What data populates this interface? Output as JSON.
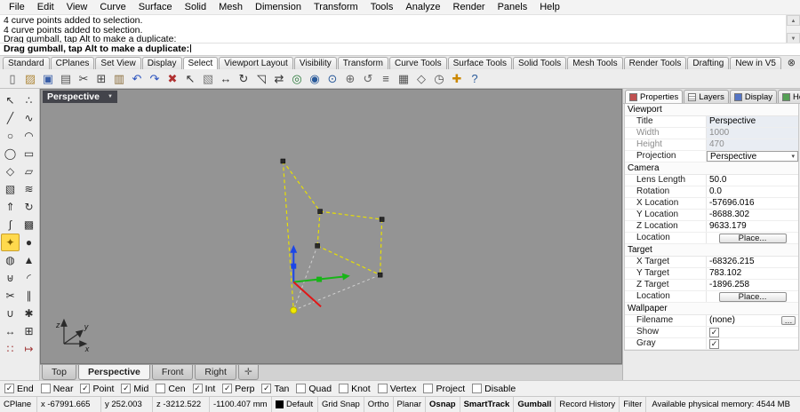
{
  "menu_bar": {
    "items": [
      "File",
      "Edit",
      "View",
      "Curve",
      "Surface",
      "Solid",
      "Mesh",
      "Dimension",
      "Transform",
      "Tools",
      "Analyze",
      "Render",
      "Panels",
      "Help"
    ]
  },
  "command_history": {
    "lines": [
      "4 curve points added to selection.",
      "4 curve points added to selection.",
      "Drag gumball, tap Alt to make a duplicate:"
    ]
  },
  "command_prompt": {
    "text": "Drag gumball, tap Alt to make a duplicate:"
  },
  "toolbar_tabs": {
    "items": [
      {
        "label": "Standard",
        "state": ""
      },
      {
        "label": "CPlanes",
        "state": ""
      },
      {
        "label": "Set View",
        "state": ""
      },
      {
        "label": "Display",
        "state": ""
      },
      {
        "label": "Select",
        "state": "active"
      },
      {
        "label": "Viewport Layout",
        "state": ""
      },
      {
        "label": "Visibility",
        "state": ""
      },
      {
        "label": "Transform",
        "state": ""
      },
      {
        "label": "Curve Tools",
        "state": ""
      },
      {
        "label": "Surface Tools",
        "state": ""
      },
      {
        "label": "Solid Tools",
        "state": ""
      },
      {
        "label": "Mesh Tools",
        "state": ""
      },
      {
        "label": "Render Tools",
        "state": ""
      },
      {
        "label": "Drafting",
        "state": ""
      },
      {
        "label": "New in V5",
        "state": ""
      }
    ]
  },
  "icon_toolbar": {
    "icons": [
      {
        "name": "new-file-icon",
        "glyph": "▯",
        "color": "#5a5a5a"
      },
      {
        "name": "open-file-icon",
        "glyph": "▨",
        "color": "#b08a3e"
      },
      {
        "name": "save-icon",
        "glyph": "▣",
        "color": "#3a5fa8"
      },
      {
        "name": "print-icon",
        "glyph": "▤",
        "color": "#5a5a5a"
      },
      {
        "name": "cut-icon",
        "glyph": "✂",
        "color": "#444444"
      },
      {
        "name": "copy-icon",
        "glyph": "⊞",
        "color": "#444444"
      },
      {
        "name": "paste-icon",
        "glyph": "▥",
        "color": "#8a6d3b"
      },
      {
        "name": "undo-icon",
        "glyph": "↶",
        "color": "#2a52be"
      },
      {
        "name": "redo-icon",
        "glyph": "↷",
        "color": "#2a52be"
      },
      {
        "name": "delete-icon",
        "glyph": "✖",
        "color": "#b03030"
      },
      {
        "name": "select-pointer-icon",
        "glyph": "↖",
        "color": "#333333"
      },
      {
        "name": "select-window-icon",
        "glyph": "▧",
        "color": "#7a7a7a"
      },
      {
        "name": "move-icon",
        "glyph": "↔",
        "color": "#333333"
      },
      {
        "name": "rotate-icon",
        "glyph": "↻",
        "color": "#333333"
      },
      {
        "name": "scale-icon",
        "glyph": "◹",
        "color": "#333333"
      },
      {
        "name": "mirror-icon",
        "glyph": "⇄",
        "color": "#333333"
      },
      {
        "name": "zoom-extents-icon",
        "glyph": "◎",
        "color": "#2a7a3a"
      },
      {
        "name": "zoom-window-icon",
        "glyph": "◉",
        "color": "#2a5a9a"
      },
      {
        "name": "zoom-selected-icon",
        "glyph": "⊙",
        "color": "#2a5a9a"
      },
      {
        "name": "pan-icon",
        "glyph": "⊕",
        "color": "#666666"
      },
      {
        "name": "undo-view-icon",
        "glyph": "↺",
        "color": "#666666"
      },
      {
        "name": "layers-icon",
        "glyph": "≡",
        "color": "#555555"
      },
      {
        "name": "display-mode-icon",
        "glyph": "▦",
        "color": "#555555"
      },
      {
        "name": "osnap-icon",
        "glyph": "◇",
        "color": "#555555"
      },
      {
        "name": "record-history-icon",
        "glyph": "◷",
        "color": "#555555"
      },
      {
        "name": "gumball-icon",
        "glyph": "✚",
        "color": "#cc8800"
      },
      {
        "name": "help-icon",
        "glyph": "?",
        "color": "#2a5a9a"
      }
    ]
  },
  "sidebar": {
    "tools": [
      {
        "name": "select-tool-icon",
        "glyph": "↖",
        "cls": ""
      },
      {
        "name": "point-tool-icon",
        "glyph": "∴",
        "cls": ""
      },
      {
        "name": "polyline-tool-icon",
        "glyph": "╱",
        "cls": ""
      },
      {
        "name": "curve-tool-icon",
        "glyph": "∿",
        "cls": ""
      },
      {
        "name": "circle-tool-icon",
        "glyph": "○",
        "cls": ""
      },
      {
        "name": "arc-tool-icon",
        "glyph": "◠",
        "cls": ""
      },
      {
        "name": "ellipse-tool-icon",
        "glyph": "◯",
        "cls": ""
      },
      {
        "name": "rectangle-tool-icon",
        "glyph": "▭",
        "cls": ""
      },
      {
        "name": "polygon-tool-icon",
        "glyph": "◇",
        "cls": ""
      },
      {
        "name": "plane-tool-icon",
        "glyph": "▱",
        "cls": ""
      },
      {
        "name": "surface-tool-icon",
        "glyph": "▧",
        "cls": ""
      },
      {
        "name": "loft-tool-icon",
        "glyph": "≋",
        "cls": ""
      },
      {
        "name": "extrude-tool-icon",
        "glyph": "⇑",
        "cls": ""
      },
      {
        "name": "revolve-tool-icon",
        "glyph": "↻",
        "cls": ""
      },
      {
        "name": "sweep-tool-icon",
        "glyph": "∫",
        "cls": ""
      },
      {
        "name": "box-tool-icon",
        "glyph": "▩",
        "cls": ""
      },
      {
        "name": "spotlight-tool-icon",
        "glyph": "✦",
        "cls": "hl"
      },
      {
        "name": "sphere-tool-icon",
        "glyph": "●",
        "cls": ""
      },
      {
        "name": "cylinder-tool-icon",
        "glyph": "◍",
        "cls": ""
      },
      {
        "name": "cone-tool-icon",
        "glyph": "▲",
        "cls": ""
      },
      {
        "name": "boolean-tool-icon",
        "glyph": "⊎",
        "cls": ""
      },
      {
        "name": "fillet-tool-icon",
        "glyph": "◜",
        "cls": ""
      },
      {
        "name": "trim-tool-icon",
        "glyph": "✂",
        "cls": ""
      },
      {
        "name": "split-tool-icon",
        "glyph": "∥",
        "cls": ""
      },
      {
        "name": "join-tool-icon",
        "glyph": "∪",
        "cls": ""
      },
      {
        "name": "explode-tool-icon",
        "glyph": "✱",
        "cls": ""
      },
      {
        "name": "move-tool-icon",
        "glyph": "↔",
        "cls": ""
      },
      {
        "name": "copy-tool-icon",
        "glyph": "⊞",
        "cls": ""
      },
      {
        "name": "array-tool-icon",
        "glyph": "∷",
        "cls": "red"
      },
      {
        "name": "dimension-tool-icon",
        "glyph": "↦",
        "cls": "red"
      }
    ]
  },
  "viewport": {
    "title": "Perspective",
    "axis_labels": {
      "x": "x",
      "y": "y",
      "z": "z"
    }
  },
  "right_panel": {
    "tabs": [
      {
        "label": "Properties",
        "name": "tab-properties",
        "icon": "properties-icon",
        "state": "active"
      },
      {
        "label": "Layers",
        "name": "tab-layers",
        "icon": "layers-icon",
        "state": ""
      },
      {
        "label": "Display",
        "name": "tab-display",
        "icon": "display-icon",
        "state": ""
      },
      {
        "label": "Help",
        "name": "tab-help",
        "icon": "help-icon",
        "state": ""
      }
    ],
    "sections": [
      {
        "title": "Viewport",
        "rows": [
          {
            "label": "Title",
            "value": "Perspective"
          },
          {
            "label": "Width",
            "value": "1000"
          },
          {
            "label": "Height",
            "value": "470"
          },
          {
            "label": "Projection",
            "value": "Perspective"
          }
        ]
      },
      {
        "title": "Camera",
        "rows": [
          {
            "label": "Lens Length",
            "value": "50.0"
          },
          {
            "label": "Rotation",
            "value": "0.0"
          },
          {
            "label": "X Location",
            "value": "-57696.016"
          },
          {
            "label": "Y Location",
            "value": "-8688.302"
          },
          {
            "label": "Z Location",
            "value": "9633.179"
          },
          {
            "label": "Location",
            "value": "Place..."
          }
        ]
      },
      {
        "title": "Target",
        "rows": [
          {
            "label": "X Target",
            "value": "-68326.215"
          },
          {
            "label": "Y Target",
            "value": "783.102"
          },
          {
            "label": "Z Target",
            "value": "-1896.258"
          },
          {
            "label": "Location",
            "value": "Place..."
          }
        ]
      },
      {
        "title": "Wallpaper",
        "rows": [
          {
            "label": "Filename",
            "value": "(none)"
          },
          {
            "label": "Show",
            "mark": "✓"
          },
          {
            "label": "Gray",
            "mark": "✓"
          }
        ]
      }
    ]
  },
  "viewport_tabs": {
    "items": [
      {
        "label": "Top",
        "name": "tab-top",
        "state": ""
      },
      {
        "label": "Perspective",
        "name": "tab-perspective",
        "state": "active"
      },
      {
        "label": "Front",
        "name": "tab-front",
        "state": ""
      },
      {
        "label": "Right",
        "name": "tab-right",
        "state": ""
      }
    ],
    "add_glyph": "✛"
  },
  "osnap_bar": {
    "items": [
      {
        "label": "End",
        "name": "osnap-end",
        "mark": "✓"
      },
      {
        "label": "Near",
        "name": "osnap-near",
        "mark": ""
      },
      {
        "label": "Point",
        "name": "osnap-point",
        "mark": "✓"
      },
      {
        "label": "Mid",
        "name": "osnap-mid",
        "mark": "✓"
      },
      {
        "label": "Cen",
        "name": "osnap-cen",
        "mark": ""
      },
      {
        "label": "Int",
        "name": "osnap-int",
        "mark": "✓"
      },
      {
        "label": "Perp",
        "name": "osnap-perp",
        "mark": "✓"
      },
      {
        "label": "Tan",
        "name": "osnap-tan",
        "mark": "✓"
      },
      {
        "label": "Quad",
        "name": "osnap-quad",
        "mark": ""
      },
      {
        "label": "Knot",
        "name": "osnap-knot",
        "mark": ""
      },
      {
        "label": "Vertex",
        "name": "osnap-vertex",
        "mark": ""
      },
      {
        "label": "Project",
        "name": "osnap-project",
        "mark": ""
      },
      {
        "label": "Disable",
        "name": "osnap-disable",
        "mark": ""
      }
    ]
  },
  "status_bar": {
    "cplane": "CPlane",
    "x": "x -67991.665",
    "y": "y 252.003",
    "z": "z -3212.522",
    "units": "-1100.407 mm",
    "layer": "Default",
    "toggles": [
      {
        "label": "Grid Snap",
        "name": "grid-snap-toggle",
        "state": ""
      },
      {
        "label": "Ortho",
        "name": "ortho-toggle",
        "state": ""
      },
      {
        "label": "Planar",
        "name": "planar-toggle",
        "state": ""
      },
      {
        "label": "Osnap",
        "name": "osnap-toggle",
        "state": "on"
      },
      {
        "label": "SmartTrack",
        "name": "smarttrack-toggle",
        "state": "on"
      },
      {
        "label": "Gumball",
        "name": "gumball-toggle",
        "state": "on"
      },
      {
        "label": "Record History",
        "name": "record-history-toggle",
        "state": ""
      },
      {
        "label": "Filter",
        "name": "filter-toggle",
        "state": ""
      }
    ],
    "memory": "Available physical memory: 4544 MB"
  },
  "icons": {
    "dropdown": "▼",
    "dropdown_small": "▾",
    "scroll_up": "▲",
    "scroll_down": "▼",
    "tab_close": "⊗",
    "panel_arrow": "◂",
    "browse": "…"
  },
  "colors": {
    "viewport_bg": "#949494",
    "selection_yellow": "#e8e000",
    "gumball_x_red": "#e01717",
    "gumball_y_green": "#17b517",
    "gumball_z_blue": "#1c46e8"
  }
}
